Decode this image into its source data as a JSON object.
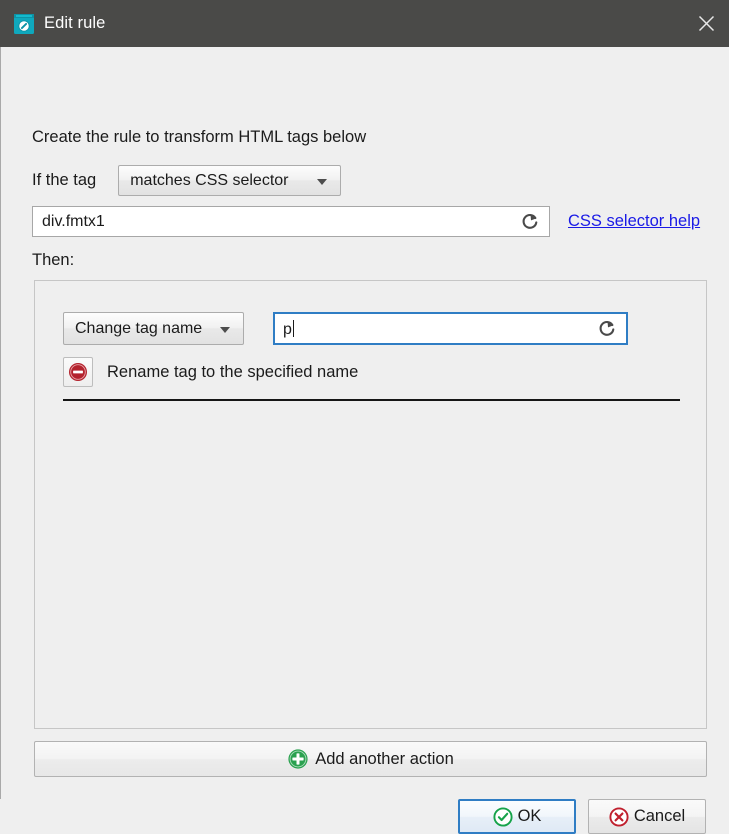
{
  "window": {
    "title": "Edit rule",
    "icon": "edit-rule-icon",
    "close_icon": "close-icon",
    "titlebar_color": "#4a4a48",
    "background_color": "#efefef"
  },
  "form": {
    "lead_text": "Create the rule to transform HTML tags below",
    "if_label": "If the tag",
    "condition": {
      "selected": "matches CSS selector",
      "options": [
        "matches CSS selector"
      ],
      "caret_icon": "chevron-down-icon"
    },
    "selector_input": {
      "value": "div.fmtx1",
      "placeholder": "",
      "reset_icon": "reset-circular-arrow-icon"
    },
    "help_link": {
      "text": "CSS selector help",
      "color": "#1a1ae6"
    },
    "then_label": "Then:"
  },
  "actions": [
    {
      "type": {
        "selected": "Change tag name",
        "options": [
          "Change tag name"
        ],
        "caret_icon": "chevron-down-icon"
      },
      "value_input": {
        "value": "p",
        "placeholder": "",
        "focused": true,
        "reset_icon": "reset-circular-arrow-icon"
      },
      "remove_icon": "remove-circle-icon",
      "description": "Rename tag to the specified name"
    }
  ],
  "add_action_button": {
    "label": "Add another action",
    "icon": "add-circle-icon",
    "icon_color": "#2aa14f"
  },
  "footer": {
    "ok": {
      "label": "OK",
      "icon": "check-circle-icon",
      "icon_color": "#16a34a",
      "is_default": true
    },
    "cancel": {
      "label": "Cancel",
      "icon": "cancel-circle-icon",
      "icon_color": "#c0202e",
      "is_default": false
    }
  }
}
